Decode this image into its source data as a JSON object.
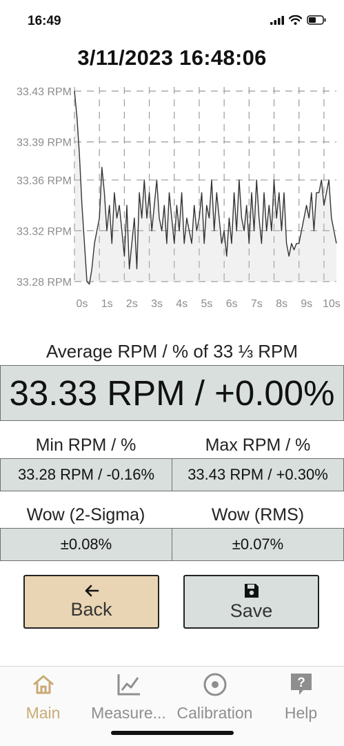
{
  "status": {
    "time": "16:49"
  },
  "header": {
    "timestamp": "3/11/2023 16:48:06"
  },
  "chart_data": {
    "type": "area",
    "title": "",
    "xlabel": "",
    "ylabel": "",
    "x_tick_labels": [
      "0s",
      "1s",
      "2s",
      "3s",
      "4s",
      "5s",
      "6s",
      "7s",
      "8s",
      "9s",
      "10s"
    ],
    "y_tick_labels": [
      "33.43 RPM",
      "33.39 RPM",
      "33.36 RPM",
      "33.32 RPM",
      "33.28 RPM"
    ],
    "y_ticks": [
      33.43,
      33.39,
      33.36,
      33.32,
      33.28
    ],
    "xlim": [
      0,
      10.5
    ],
    "ylim": [
      33.28,
      33.43
    ],
    "grid": true,
    "series": [
      {
        "x": [
          0,
          0.1,
          0.2,
          0.3,
          0.4,
          0.5,
          0.6,
          0.7,
          0.8,
          0.9,
          1.0,
          1.1,
          1.2,
          1.3,
          1.4,
          1.5,
          1.6,
          1.7,
          1.8,
          1.9,
          2.0,
          2.1,
          2.2,
          2.3,
          2.4,
          2.5,
          2.6,
          2.7,
          2.8,
          2.9,
          3.0,
          3.1,
          3.2,
          3.3,
          3.4,
          3.5,
          3.6,
          3.7,
          3.8,
          3.9,
          4.0,
          4.1,
          4.2,
          4.3,
          4.4,
          4.5,
          4.6,
          4.7,
          4.8,
          4.9,
          5.0,
          5.1,
          5.2,
          5.3,
          5.4,
          5.5,
          5.6,
          5.7,
          5.8,
          5.9,
          6.0,
          6.1,
          6.2,
          6.3,
          6.4,
          6.5,
          6.6,
          6.7,
          6.8,
          6.9,
          7.0,
          7.1,
          7.2,
          7.3,
          7.4,
          7.5,
          7.6,
          7.7,
          7.8,
          7.9,
          8.0,
          8.1,
          8.2,
          8.3,
          8.4,
          8.5,
          8.6,
          8.7,
          8.8,
          8.9,
          9.0,
          9.1,
          9.2,
          9.3,
          9.4,
          9.5,
          9.6,
          9.7,
          9.8,
          9.9,
          10.0,
          10.1,
          10.2,
          10.3,
          10.4,
          10.5
        ],
        "values": [
          33.43,
          33.41,
          33.38,
          33.34,
          33.31,
          33.28,
          33.278,
          33.29,
          33.31,
          33.32,
          33.33,
          33.37,
          33.35,
          33.32,
          33.34,
          33.31,
          33.35,
          33.33,
          33.34,
          33.32,
          33.3,
          33.34,
          33.29,
          33.31,
          33.33,
          33.29,
          33.35,
          33.33,
          33.36,
          33.33,
          33.35,
          33.32,
          33.34,
          33.36,
          33.33,
          33.32,
          33.34,
          33.31,
          33.35,
          33.33,
          33.31,
          33.34,
          33.32,
          33.35,
          33.31,
          33.33,
          33.32,
          33.31,
          33.34,
          33.32,
          33.33,
          33.35,
          33.31,
          33.34,
          33.33,
          33.36,
          33.32,
          33.35,
          33.33,
          33.31,
          33.32,
          33.3,
          33.33,
          33.31,
          33.35,
          33.32,
          33.36,
          33.33,
          33.32,
          33.34,
          33.31,
          33.35,
          33.32,
          33.36,
          33.33,
          33.31,
          33.35,
          33.32,
          33.34,
          33.32,
          33.36,
          33.33,
          33.35,
          33.32,
          33.35,
          33.31,
          33.3,
          33.31,
          33.305,
          33.31,
          33.31,
          33.32,
          33.33,
          33.34,
          33.33,
          33.35,
          33.32,
          33.35,
          33.35,
          33.36,
          33.34,
          33.35,
          33.36,
          33.33,
          33.32,
          33.31
        ]
      }
    ]
  },
  "average": {
    "label": "Average RPM / % of 33 ⅓ RPM",
    "value": "33.33 RPM / +0.00%"
  },
  "min": {
    "label": "Min RPM / %",
    "value": "33.28 RPM / -0.16%"
  },
  "max": {
    "label": "Max RPM / %",
    "value": "33.43 RPM / +0.30%"
  },
  "wow_2sigma": {
    "label": "Wow (2-Sigma)",
    "value": "±0.08%"
  },
  "wow_rms": {
    "label": "Wow (RMS)",
    "value": "±0.07%"
  },
  "buttons": {
    "back": {
      "label": "Back",
      "icon": "arrow-left-icon",
      "color": "#e9d5b3"
    },
    "save": {
      "label": "Save",
      "icon": "floppy-disk-icon",
      "color": "#d8dfdd"
    }
  },
  "tabs": [
    {
      "label": "Main",
      "icon": "home-icon",
      "active": true
    },
    {
      "label": "Measure...",
      "icon": "line-chart-icon",
      "active": false
    },
    {
      "label": "Calibration",
      "icon": "target-icon",
      "active": false
    },
    {
      "label": "Help",
      "icon": "help-icon",
      "active": false
    }
  ],
  "colors": {
    "accent": "#c9aa74",
    "inactive": "#8e8e8e",
    "box": "#d8dfdd"
  }
}
